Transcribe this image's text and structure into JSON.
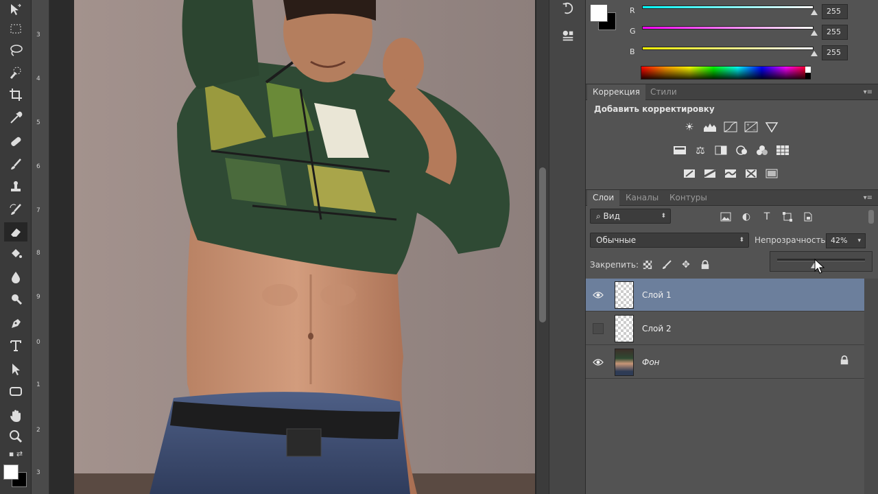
{
  "color_panel": {
    "channels": [
      {
        "label": "R",
        "value": "255",
        "gradient": [
          "#00ffff",
          "#ffffff"
        ]
      },
      {
        "label": "G",
        "value": "255",
        "gradient": [
          "#ff00ff",
          "#ffffff"
        ]
      },
      {
        "label": "B",
        "value": "255",
        "gradient": [
          "#ffff00",
          "#ffffff"
        ]
      }
    ],
    "foreground": "#ffffff",
    "background": "#000000"
  },
  "adjustments": {
    "tabs": [
      "Коррекция",
      "Стили"
    ],
    "title": "Добавить корректировку",
    "icons": [
      "brightness-icon",
      "levels-icon",
      "curves-icon",
      "exposure-icon",
      "vibrance-icon",
      "hue-saturation-icon",
      "color-balance-icon",
      "black-white-icon",
      "photo-filter-icon",
      "channel-mixer-icon",
      "color-lookup-icon",
      "invert-icon",
      "posterize-icon",
      "threshold-icon",
      "selective-color-icon",
      "gradient-map-icon"
    ]
  },
  "layers_panel": {
    "tabs": [
      "Слои",
      "Каналы",
      "Контуры"
    ],
    "filter_label": "Вид",
    "blend_mode": "Обычные",
    "opacity_label": "Непрозрачность:",
    "opacity_value": "42%",
    "opacity_fraction": 0.42,
    "lock_label": "Закрепить:",
    "layers": [
      {
        "name": "Слой 1",
        "visible": true,
        "selected": true
      },
      {
        "name": "Слой 2",
        "visible": false,
        "selected": false
      },
      {
        "name": "Фон",
        "visible": true,
        "selected": false,
        "locked": true
      }
    ]
  },
  "ruler": {
    "numbers": [
      "3",
      "4",
      "5",
      "6",
      "7",
      "8",
      "9",
      "0",
      "1",
      "2",
      "3"
    ]
  },
  "colors": {
    "panel_bg": "#535353",
    "selection": "#6c7f9c",
    "toolbar_bg": "#3a3a3a"
  }
}
